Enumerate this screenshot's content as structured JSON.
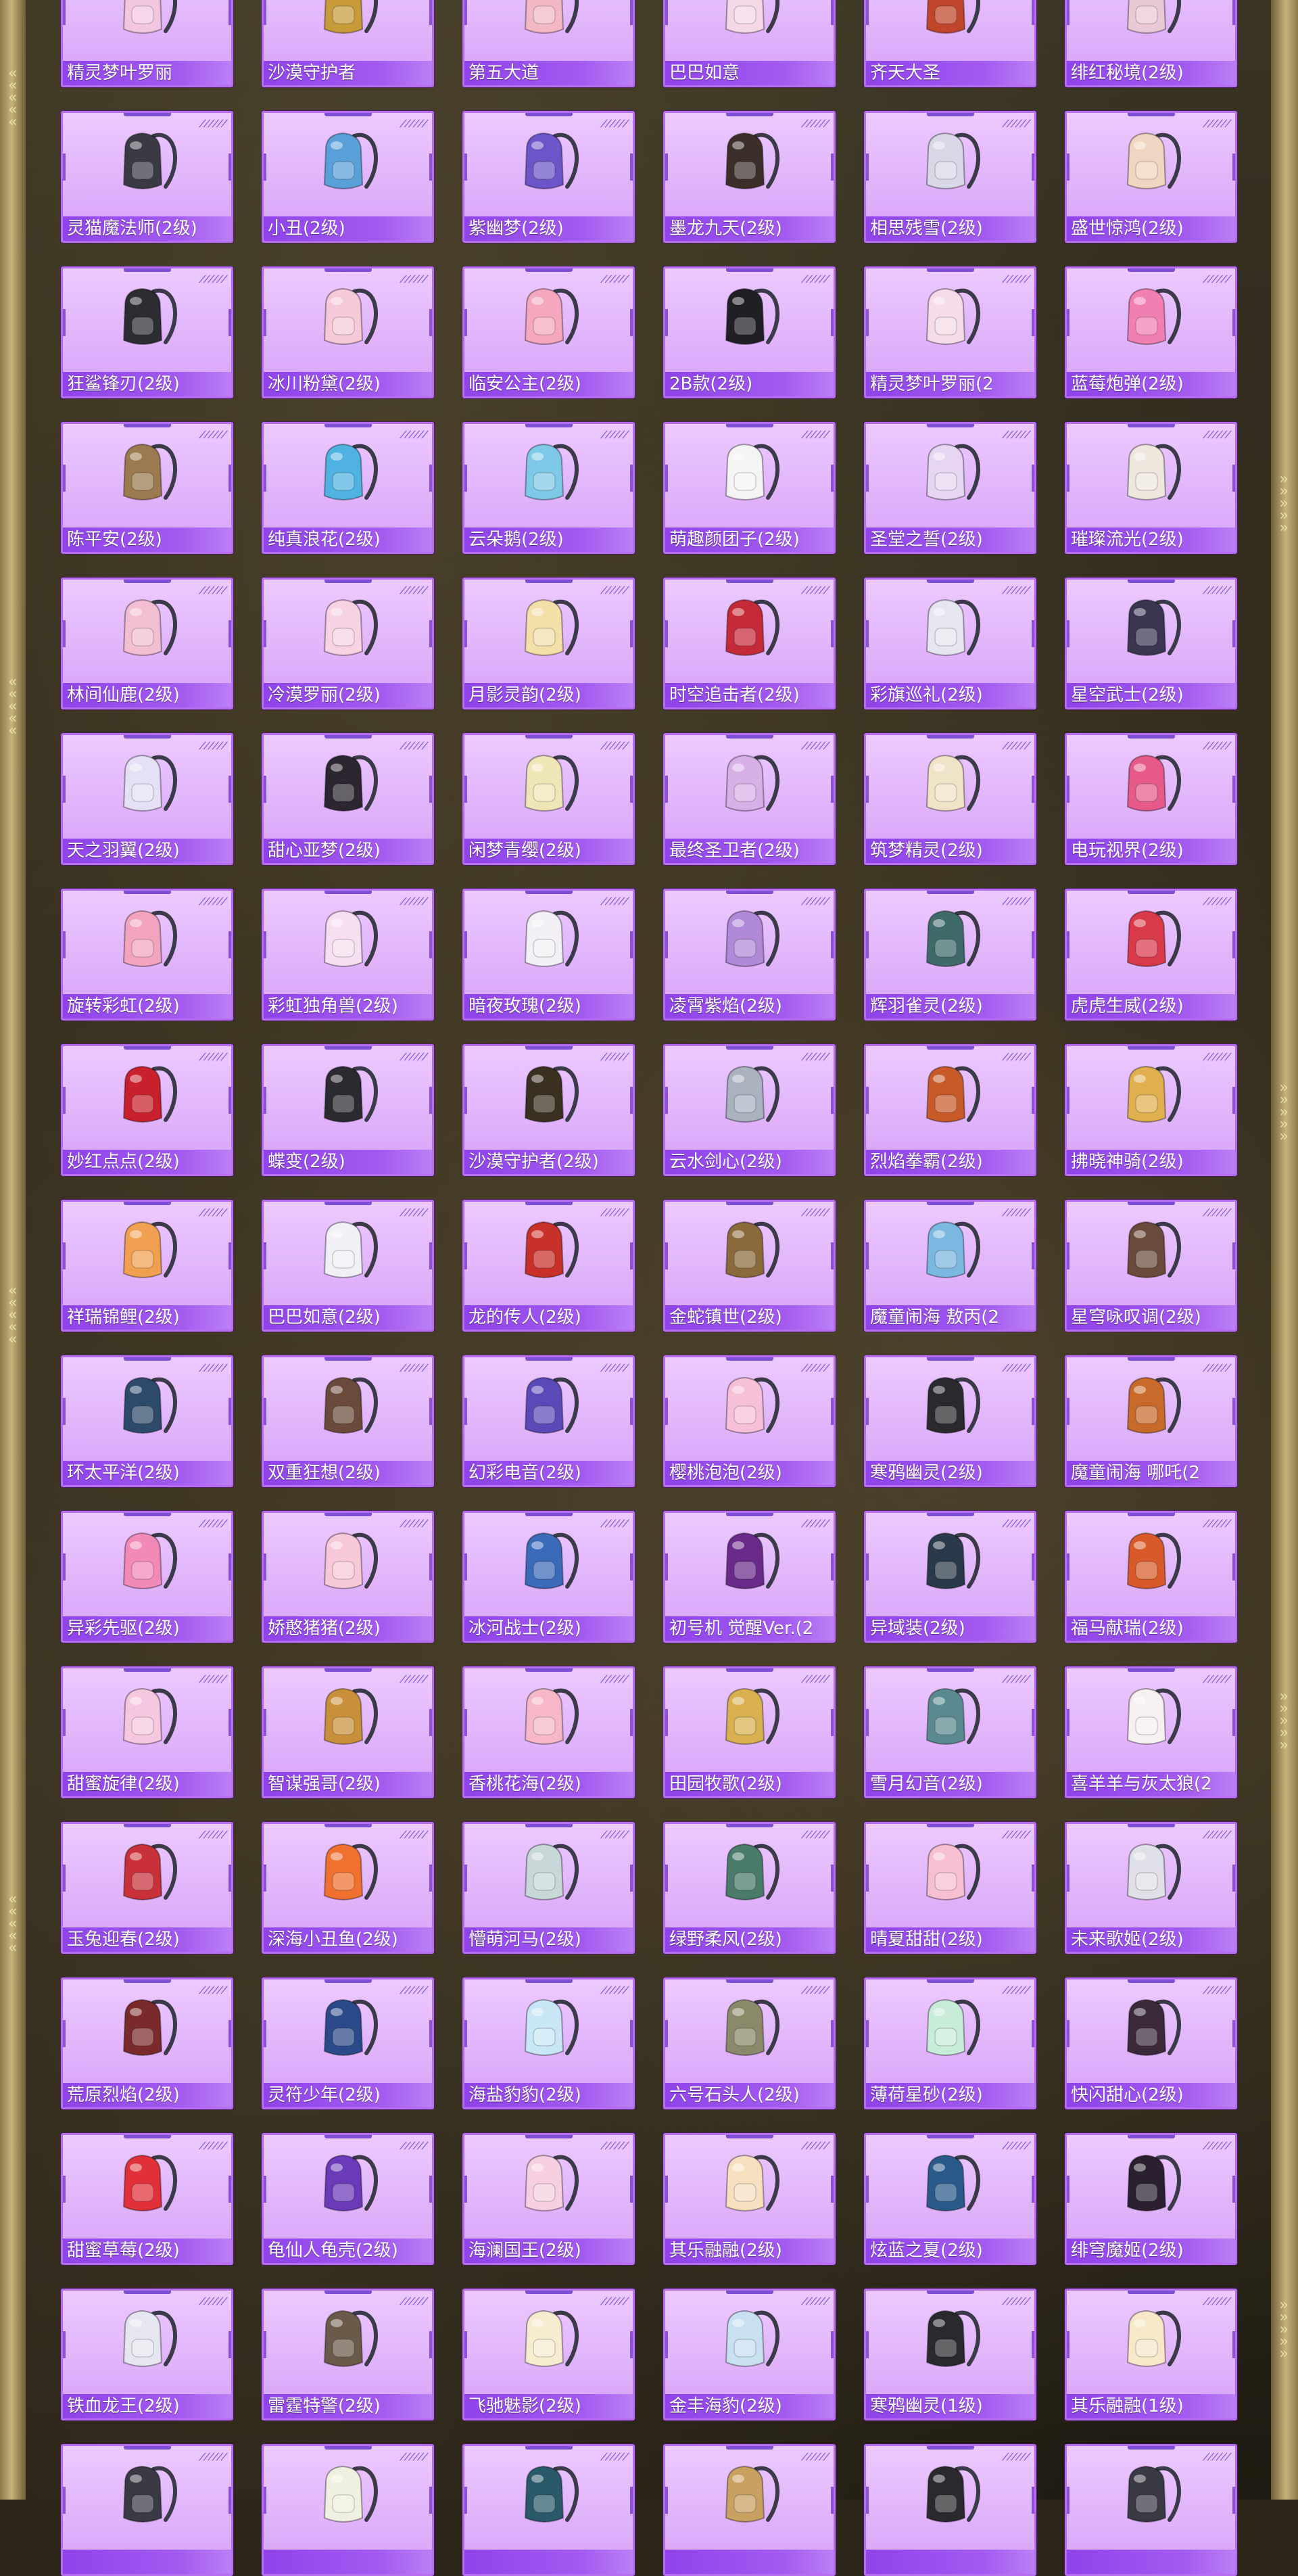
{
  "grid": {
    "columns": 6,
    "items": [
      {
        "name": "精灵梦叶罗丽",
        "icon": "backpack-icon",
        "color": "#f3c6df"
      },
      {
        "name": "沙漠守护者",
        "icon": "backpack-icon",
        "color": "#c79a3a"
      },
      {
        "name": "第五大道",
        "icon": "backpack-icon",
        "color": "#f2b8c4"
      },
      {
        "name": "巴巴如意",
        "icon": "backpack-icon",
        "color": "#f4d8e6"
      },
      {
        "name": "齐天大圣",
        "icon": "backpack-icon",
        "color": "#c0452a"
      },
      {
        "name": "绯红秘境(2级)",
        "icon": "backpack-icon",
        "color": "#e9c9d6"
      },
      {
        "name": "灵猫魔法师(2级)",
        "icon": "backpack-icon",
        "color": "#3a3a44"
      },
      {
        "name": "小丑(2级)",
        "icon": "backpack-icon",
        "color": "#5aa0d8"
      },
      {
        "name": "紫幽梦(2级)",
        "icon": "backpack-icon",
        "color": "#6b55c8"
      },
      {
        "name": "墨龙九天(2级)",
        "icon": "backpack-icon",
        "color": "#3c2f2a"
      },
      {
        "name": "相思残雪(2级)",
        "icon": "backpack-icon",
        "color": "#d8d8e6"
      },
      {
        "name": "盛世惊鸿(2级)",
        "icon": "backpack-icon",
        "color": "#f0d6c0"
      },
      {
        "name": "狂鲨锋刃(2级)",
        "icon": "backpack-icon",
        "color": "#2c2c33"
      },
      {
        "name": "冰川粉黛(2级)",
        "icon": "backpack-icon",
        "color": "#f6c9d8"
      },
      {
        "name": "临安公主(2级)",
        "icon": "backpack-icon",
        "color": "#f5a8bd"
      },
      {
        "name": "2B款(2级)",
        "icon": "backpack-icon",
        "color": "#1f1f24"
      },
      {
        "name": "精灵梦叶罗丽(2",
        "icon": "backpack-icon",
        "color": "#f6dbe8"
      },
      {
        "name": "蓝莓炮弹(2级)",
        "icon": "backpack-icon",
        "color": "#f27fb2"
      },
      {
        "name": "陈平安(2级)",
        "icon": "backpack-icon",
        "color": "#9a7a4e"
      },
      {
        "name": "纯真浪花(2级)",
        "icon": "backpack-icon",
        "color": "#4fb2e0"
      },
      {
        "name": "云朵鹅(2级)",
        "icon": "backpack-icon",
        "color": "#7ec8e8"
      },
      {
        "name": "萌趣颜团子(2级)",
        "icon": "backpack-icon",
        "color": "#f4f4f4"
      },
      {
        "name": "圣堂之誓(2级)",
        "icon": "backpack-icon",
        "color": "#e6d6f2"
      },
      {
        "name": "璀璨流光(2级)",
        "icon": "backpack-icon",
        "color": "#efe6de"
      },
      {
        "name": "林间仙鹿(2级)",
        "icon": "backpack-icon",
        "color": "#f2bfd2"
      },
      {
        "name": "冷漠罗丽(2级)",
        "icon": "backpack-icon",
        "color": "#f6d2e2"
      },
      {
        "name": "月影灵韵(2级)",
        "icon": "backpack-icon",
        "color": "#f2e0a8"
      },
      {
        "name": "时空追击者(2级)",
        "icon": "backpack-icon",
        "color": "#c52a38"
      },
      {
        "name": "彩旗巡礼(2级)",
        "icon": "backpack-icon",
        "color": "#e6e6f0"
      },
      {
        "name": "星空武士(2级)",
        "icon": "backpack-icon",
        "color": "#3a3650"
      },
      {
        "name": "天之羽翼(2级)",
        "icon": "backpack-icon",
        "color": "#e6e0f6"
      },
      {
        "name": "甜心亚梦(2级)",
        "icon": "backpack-icon",
        "color": "#2b2630"
      },
      {
        "name": "闲梦青缨(2级)",
        "icon": "backpack-icon",
        "color": "#efe6b8"
      },
      {
        "name": "最终圣卫者(2级)",
        "icon": "backpack-icon",
        "color": "#d8b0e8"
      },
      {
        "name": "筑梦精灵(2级)",
        "icon": "backpack-icon",
        "color": "#f0e4c8"
      },
      {
        "name": "电玩视界(2级)",
        "icon": "backpack-icon",
        "color": "#e65a8a"
      },
      {
        "name": "旋转彩虹(2级)",
        "icon": "backpack-icon",
        "color": "#f2a4bf"
      },
      {
        "name": "彩虹独角兽(2级)",
        "icon": "backpack-icon",
        "color": "#f6dff0"
      },
      {
        "name": "暗夜玫瑰(2级)",
        "icon": "backpack-icon",
        "color": "#f2f0f4"
      },
      {
        "name": "凌霄紫焰(2级)",
        "icon": "backpack-icon",
        "color": "#b08ad8"
      },
      {
        "name": "辉羽雀灵(2级)",
        "icon": "backpack-icon",
        "color": "#3f6a6a"
      },
      {
        "name": "虎虎生威(2级)",
        "icon": "backpack-icon",
        "color": "#d83a4a"
      },
      {
        "name": "妙红点点(2级)",
        "icon": "backpack-icon",
        "color": "#c8202c"
      },
      {
        "name": "蝶变(2级)",
        "icon": "backpack-icon",
        "color": "#2a2a30"
      },
      {
        "name": "沙漠守护者(2级)",
        "icon": "backpack-icon",
        "color": "#3a3020"
      },
      {
        "name": "云水剑心(2级)",
        "icon": "backpack-icon",
        "color": "#aab2c0"
      },
      {
        "name": "烈焰拳霸(2级)",
        "icon": "backpack-icon",
        "color": "#c85a2a"
      },
      {
        "name": "拂晓神骑(2级)",
        "icon": "backpack-icon",
        "color": "#e0b050"
      },
      {
        "name": "祥瑞锦鲤(2级)",
        "icon": "backpack-icon",
        "color": "#f0a050"
      },
      {
        "name": "巴巴如意(2级)",
        "icon": "backpack-icon",
        "color": "#f0f0f6"
      },
      {
        "name": "龙的传人(2级)",
        "icon": "backpack-icon",
        "color": "#c8302a"
      },
      {
        "name": "金蛇镇世(2级)",
        "icon": "backpack-icon",
        "color": "#8a6a3a"
      },
      {
        "name": "魔童闹海 敖丙(2",
        "icon": "backpack-icon",
        "color": "#7ab8e0"
      },
      {
        "name": "星穹咏叹调(2级)",
        "icon": "backpack-icon",
        "color": "#6a4a3a"
      },
      {
        "name": "环太平洋(2级)",
        "icon": "backpack-icon",
        "color": "#2e4a6a"
      },
      {
        "name": "双重狂想(2级)",
        "icon": "backpack-icon",
        "color": "#6a4a3a"
      },
      {
        "name": "幻彩电音(2级)",
        "icon": "backpack-icon",
        "color": "#5a4ab8"
      },
      {
        "name": "樱桃泡泡(2级)",
        "icon": "backpack-icon",
        "color": "#f6c0d8"
      },
      {
        "name": "寒鸦幽灵(2级)",
        "icon": "backpack-icon",
        "color": "#2a2a2e"
      },
      {
        "name": "魔童闹海 哪吒(2",
        "icon": "backpack-icon",
        "color": "#c86a2a"
      },
      {
        "name": "异彩先驱(2级)",
        "icon": "backpack-icon",
        "color": "#f28ab8"
      },
      {
        "name": "娇憨猪猪(2级)",
        "icon": "backpack-icon",
        "color": "#f6c8d8"
      },
      {
        "name": "冰河战士(2级)",
        "icon": "backpack-icon",
        "color": "#3a6ab8"
      },
      {
        "name": "初号机 觉醒Ver.(2",
        "icon": "backpack-icon",
        "color": "#6a2a8a"
      },
      {
        "name": "异域装(2级)",
        "icon": "backpack-icon",
        "color": "#2a3a4a"
      },
      {
        "name": "福马献瑞(2级)",
        "icon": "backpack-icon",
        "color": "#d85a2a"
      },
      {
        "name": "甜蜜旋律(2级)",
        "icon": "backpack-icon",
        "color": "#f6c8e0"
      },
      {
        "name": "智谋强哥(2级)",
        "icon": "backpack-icon",
        "color": "#c8903a"
      },
      {
        "name": "香桃花海(2级)",
        "icon": "backpack-icon",
        "color": "#f6b8c8"
      },
      {
        "name": "田园牧歌(2级)",
        "icon": "backpack-icon",
        "color": "#d8b050"
      },
      {
        "name": "雪月幻音(2级)",
        "icon": "backpack-icon",
        "color": "#5a8a90"
      },
      {
        "name": "喜羊羊与灰太狼(2",
        "icon": "backpack-icon",
        "color": "#f6f0f0"
      },
      {
        "name": "玉兔迎春(2级)",
        "icon": "backpack-icon",
        "color": "#c8303a"
      },
      {
        "name": "深海小丑鱼(2级)",
        "icon": "backpack-icon",
        "color": "#f07030"
      },
      {
        "name": "懵萌河马(2级)",
        "icon": "backpack-icon",
        "color": "#c8d8d8"
      },
      {
        "name": "绿野柔风(2级)",
        "icon": "backpack-icon",
        "color": "#4a7a6a"
      },
      {
        "name": "晴夏甜甜(2级)",
        "icon": "backpack-icon",
        "color": "#f6c0d0"
      },
      {
        "name": "未来歌姬(2级)",
        "icon": "backpack-icon",
        "color": "#e0e0e8"
      },
      {
        "name": "荒原烈焰(2级)",
        "icon": "backpack-icon",
        "color": "#7a2a2a"
      },
      {
        "name": "灵符少年(2级)",
        "icon": "backpack-icon",
        "color": "#2a4a8a"
      },
      {
        "name": "海盐豹豹(2级)",
        "icon": "backpack-icon",
        "color": "#c8e6f6"
      },
      {
        "name": "六号石头人(2级)",
        "icon": "backpack-icon",
        "color": "#8a8a6a"
      },
      {
        "name": "薄荷星砂(2级)",
        "icon": "backpack-icon",
        "color": "#c8ecd8"
      },
      {
        "name": "快闪甜心(2级)",
        "icon": "backpack-icon",
        "color": "#3a2a3a"
      },
      {
        "name": "甜蜜草莓(2级)",
        "icon": "backpack-icon",
        "color": "#e0303a"
      },
      {
        "name": "龟仙人龟壳(2级)",
        "icon": "backpack-icon",
        "color": "#6a3ab8"
      },
      {
        "name": "海澜国王(2级)",
        "icon": "backpack-icon",
        "color": "#f6d0e0"
      },
      {
        "name": "其乐融融(2级)",
        "icon": "backpack-icon",
        "color": "#f6e0c0"
      },
      {
        "name": "炫蓝之夏(2级)",
        "icon": "backpack-icon",
        "color": "#2a5a8a"
      },
      {
        "name": "绯穹魔姬(2级)",
        "icon": "backpack-icon",
        "color": "#2a2030"
      },
      {
        "name": "铁血龙王(2级)",
        "icon": "backpack-icon",
        "color": "#e6e6f0"
      },
      {
        "name": "雷霆特警(2级)",
        "icon": "backpack-icon",
        "color": "#6a5a4a"
      },
      {
        "name": "飞驰魅影(2级)",
        "icon": "backpack-icon",
        "color": "#f6ecd0"
      },
      {
        "name": "金丰海豹(2级)",
        "icon": "backpack-icon",
        "color": "#c8e0f0"
      },
      {
        "name": "寒鸦幽灵(1级)",
        "icon": "backpack-icon",
        "color": "#2a2a2e"
      },
      {
        "name": "其乐融融(1级)",
        "icon": "backpack-icon",
        "color": "#f6e8c8"
      },
      {
        "name": "",
        "icon": "backpack-icon",
        "color": "#3a3a44"
      },
      {
        "name": "",
        "icon": "backpack-icon",
        "color": "#f0f0e0"
      },
      {
        "name": "",
        "icon": "backpack-icon",
        "color": "#2a5a6a"
      },
      {
        "name": "",
        "icon": "backpack-icon",
        "color": "#c8a060"
      },
      {
        "name": "",
        "icon": "backpack-icon",
        "color": "#2a2a2e"
      },
      {
        "name": "",
        "icon": "backpack-icon",
        "color": "#3a3a44"
      }
    ]
  }
}
